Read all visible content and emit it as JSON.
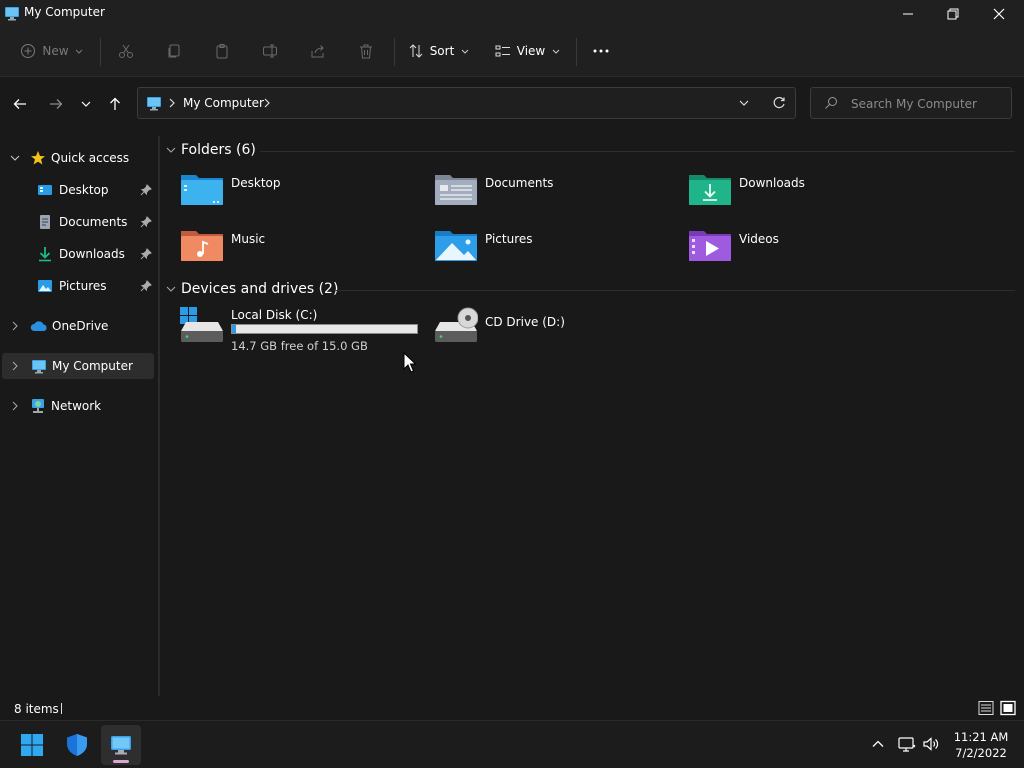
{
  "window": {
    "title": "My Computer"
  },
  "toolbar": {
    "new_label": "New",
    "sort_label": "Sort",
    "view_label": "View"
  },
  "address": {
    "location": "My Computer",
    "search_placeholder": "Search My Computer"
  },
  "sidebar": {
    "quick_access": "Quick access",
    "quick_items": [
      {
        "label": "Desktop"
      },
      {
        "label": "Documents"
      },
      {
        "label": "Downloads"
      },
      {
        "label": "Pictures"
      }
    ],
    "onedrive": "OneDrive",
    "my_computer": "My Computer",
    "network": "Network"
  },
  "content": {
    "folders_header": "Folders (6)",
    "folders": [
      {
        "label": "Desktop"
      },
      {
        "label": "Documents"
      },
      {
        "label": "Downloads"
      },
      {
        "label": "Music"
      },
      {
        "label": "Pictures"
      },
      {
        "label": "Videos"
      }
    ],
    "drives_header": "Devices and drives (2)",
    "drives": [
      {
        "label": "Local Disk (C:)",
        "free_text": "14.7 GB free of 15.0 GB",
        "used_fraction": 0.02
      },
      {
        "label": "CD Drive (D:)"
      }
    ]
  },
  "status": {
    "items_count": "8 items"
  },
  "taskbar": {
    "time": "11:21 AM",
    "date": "7/2/2022"
  },
  "colors": {
    "accent": "#2b9be8",
    "selected_bg": "#2d2d2d",
    "window_bg": "#191919"
  }
}
